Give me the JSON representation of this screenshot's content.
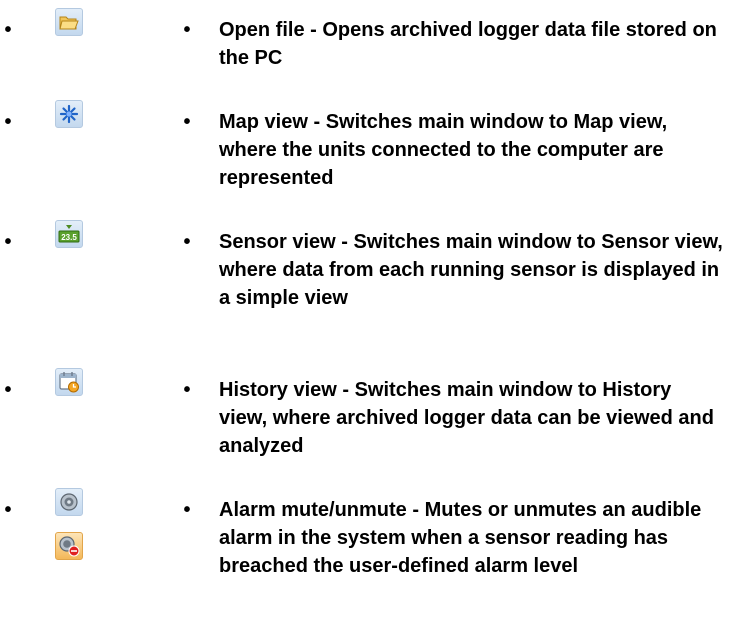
{
  "items": [
    {
      "icons": [
        "open-folder-icon"
      ],
      "text": "Open file - Opens archived logger data file stored on the PC"
    },
    {
      "icons": [
        "star-burst-icon"
      ],
      "text": "Map view - Switches main window to Map view, where the units connected to the computer are represented"
    },
    {
      "icons": [
        "sensor-display-icon"
      ],
      "text": "Sensor view - Switches main window to Sensor view, where data from each running sensor is displayed in a simple view"
    },
    {
      "icons": [
        "calendar-clock-icon"
      ],
      "text": "History view - Switches main window to History view, where archived logger data can be viewed and analyzed"
    },
    {
      "icons": [
        "speaker-icon",
        "speaker-muted-icon"
      ],
      "text": "Alarm mute/unmute - Mutes or unmutes an audible alarm in the system when a sensor reading has breached the user-defined alarm level"
    }
  ],
  "bullet_char": "•",
  "sensor_icon_text": "23.5"
}
